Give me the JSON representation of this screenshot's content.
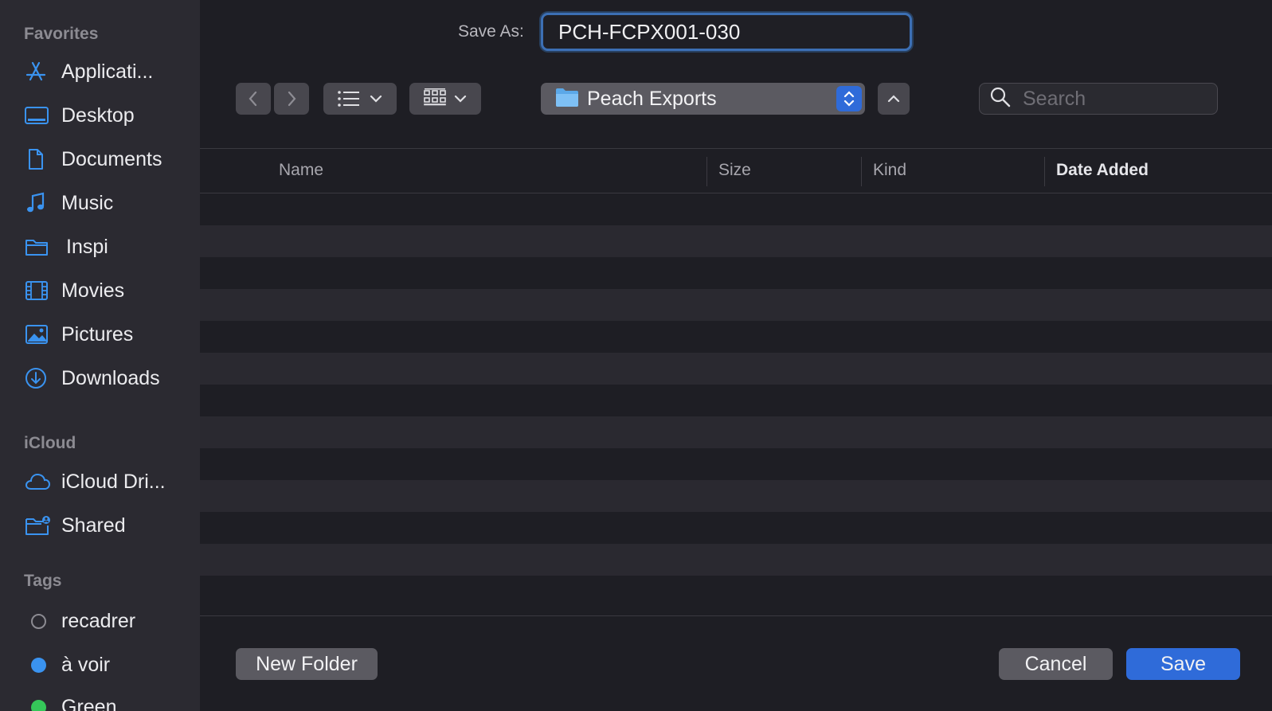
{
  "sidebar": {
    "favorites_heading": "Favorites",
    "favorites": [
      {
        "label": "Applicati...",
        "icon": "applications-icon"
      },
      {
        "label": "Desktop",
        "icon": "desktop-icon"
      },
      {
        "label": "Documents",
        "icon": "document-icon"
      },
      {
        "label": "Music",
        "icon": "music-icon"
      },
      {
        "label": "Inspi",
        "icon": "folder-icon"
      },
      {
        "label": "Movies",
        "icon": "movies-icon"
      },
      {
        "label": "Pictures",
        "icon": "pictures-icon"
      },
      {
        "label": "Downloads",
        "icon": "downloads-icon"
      }
    ],
    "icloud_heading": "iCloud",
    "icloud": [
      {
        "label": "iCloud Dri...",
        "icon": "cloud-icon"
      },
      {
        "label": "Shared",
        "icon": "shared-folder-icon"
      }
    ],
    "tags_heading": "Tags",
    "tags": [
      {
        "label": "recadrer",
        "color": "none"
      },
      {
        "label": "à voir",
        "color": "#3a93f0"
      },
      {
        "label": "Green",
        "color": "#35c759"
      }
    ]
  },
  "save_as": {
    "label": "Save As:",
    "value": "PCH-FCPX001-030"
  },
  "toolbar": {
    "back_icon": "chevron-left-icon",
    "forward_icon": "chevron-right-icon",
    "list_view_icon": "list-view-icon",
    "gallery_view_icon": "grid-view-icon",
    "location": "Peach Exports",
    "search_placeholder": "Search"
  },
  "columns": {
    "name": "Name",
    "size": "Size",
    "kind": "Kind",
    "date_added": "Date Added"
  },
  "buttons": {
    "new_folder": "New Folder",
    "cancel": "Cancel",
    "save": "Save"
  },
  "colors": {
    "accent": "#2f6bd9",
    "sidebar_icon": "#3a93f0"
  }
}
